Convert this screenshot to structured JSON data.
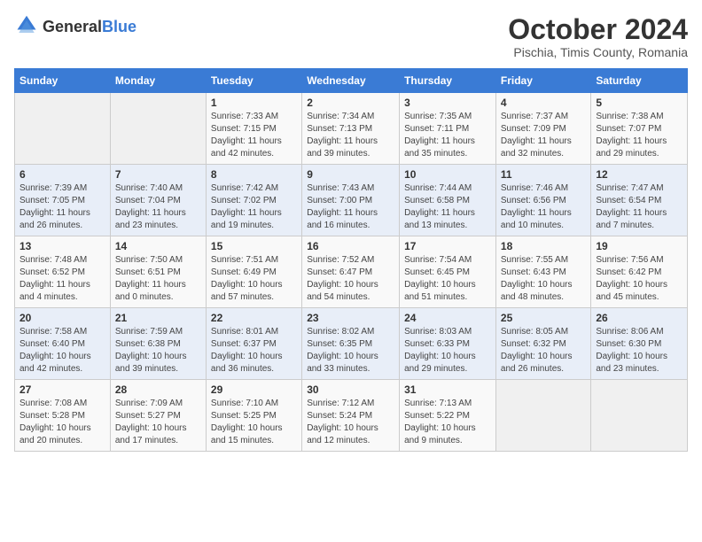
{
  "header": {
    "logo_general": "General",
    "logo_blue": "Blue",
    "month": "October 2024",
    "location": "Pischia, Timis County, Romania"
  },
  "days_of_week": [
    "Sunday",
    "Monday",
    "Tuesday",
    "Wednesday",
    "Thursday",
    "Friday",
    "Saturday"
  ],
  "weeks": [
    [
      {
        "day": "",
        "info": ""
      },
      {
        "day": "",
        "info": ""
      },
      {
        "day": "1",
        "info": "Sunrise: 7:33 AM\nSunset: 7:15 PM\nDaylight: 11 hours and 42 minutes."
      },
      {
        "day": "2",
        "info": "Sunrise: 7:34 AM\nSunset: 7:13 PM\nDaylight: 11 hours and 39 minutes."
      },
      {
        "day": "3",
        "info": "Sunrise: 7:35 AM\nSunset: 7:11 PM\nDaylight: 11 hours and 35 minutes."
      },
      {
        "day": "4",
        "info": "Sunrise: 7:37 AM\nSunset: 7:09 PM\nDaylight: 11 hours and 32 minutes."
      },
      {
        "day": "5",
        "info": "Sunrise: 7:38 AM\nSunset: 7:07 PM\nDaylight: 11 hours and 29 minutes."
      }
    ],
    [
      {
        "day": "6",
        "info": "Sunrise: 7:39 AM\nSunset: 7:05 PM\nDaylight: 11 hours and 26 minutes."
      },
      {
        "day": "7",
        "info": "Sunrise: 7:40 AM\nSunset: 7:04 PM\nDaylight: 11 hours and 23 minutes."
      },
      {
        "day": "8",
        "info": "Sunrise: 7:42 AM\nSunset: 7:02 PM\nDaylight: 11 hours and 19 minutes."
      },
      {
        "day": "9",
        "info": "Sunrise: 7:43 AM\nSunset: 7:00 PM\nDaylight: 11 hours and 16 minutes."
      },
      {
        "day": "10",
        "info": "Sunrise: 7:44 AM\nSunset: 6:58 PM\nDaylight: 11 hours and 13 minutes."
      },
      {
        "day": "11",
        "info": "Sunrise: 7:46 AM\nSunset: 6:56 PM\nDaylight: 11 hours and 10 minutes."
      },
      {
        "day": "12",
        "info": "Sunrise: 7:47 AM\nSunset: 6:54 PM\nDaylight: 11 hours and 7 minutes."
      }
    ],
    [
      {
        "day": "13",
        "info": "Sunrise: 7:48 AM\nSunset: 6:52 PM\nDaylight: 11 hours and 4 minutes."
      },
      {
        "day": "14",
        "info": "Sunrise: 7:50 AM\nSunset: 6:51 PM\nDaylight: 11 hours and 0 minutes."
      },
      {
        "day": "15",
        "info": "Sunrise: 7:51 AM\nSunset: 6:49 PM\nDaylight: 10 hours and 57 minutes."
      },
      {
        "day": "16",
        "info": "Sunrise: 7:52 AM\nSunset: 6:47 PM\nDaylight: 10 hours and 54 minutes."
      },
      {
        "day": "17",
        "info": "Sunrise: 7:54 AM\nSunset: 6:45 PM\nDaylight: 10 hours and 51 minutes."
      },
      {
        "day": "18",
        "info": "Sunrise: 7:55 AM\nSunset: 6:43 PM\nDaylight: 10 hours and 48 minutes."
      },
      {
        "day": "19",
        "info": "Sunrise: 7:56 AM\nSunset: 6:42 PM\nDaylight: 10 hours and 45 minutes."
      }
    ],
    [
      {
        "day": "20",
        "info": "Sunrise: 7:58 AM\nSunset: 6:40 PM\nDaylight: 10 hours and 42 minutes."
      },
      {
        "day": "21",
        "info": "Sunrise: 7:59 AM\nSunset: 6:38 PM\nDaylight: 10 hours and 39 minutes."
      },
      {
        "day": "22",
        "info": "Sunrise: 8:01 AM\nSunset: 6:37 PM\nDaylight: 10 hours and 36 minutes."
      },
      {
        "day": "23",
        "info": "Sunrise: 8:02 AM\nSunset: 6:35 PM\nDaylight: 10 hours and 33 minutes."
      },
      {
        "day": "24",
        "info": "Sunrise: 8:03 AM\nSunset: 6:33 PM\nDaylight: 10 hours and 29 minutes."
      },
      {
        "day": "25",
        "info": "Sunrise: 8:05 AM\nSunset: 6:32 PM\nDaylight: 10 hours and 26 minutes."
      },
      {
        "day": "26",
        "info": "Sunrise: 8:06 AM\nSunset: 6:30 PM\nDaylight: 10 hours and 23 minutes."
      }
    ],
    [
      {
        "day": "27",
        "info": "Sunrise: 7:08 AM\nSunset: 5:28 PM\nDaylight: 10 hours and 20 minutes."
      },
      {
        "day": "28",
        "info": "Sunrise: 7:09 AM\nSunset: 5:27 PM\nDaylight: 10 hours and 17 minutes."
      },
      {
        "day": "29",
        "info": "Sunrise: 7:10 AM\nSunset: 5:25 PM\nDaylight: 10 hours and 15 minutes."
      },
      {
        "day": "30",
        "info": "Sunrise: 7:12 AM\nSunset: 5:24 PM\nDaylight: 10 hours and 12 minutes."
      },
      {
        "day": "31",
        "info": "Sunrise: 7:13 AM\nSunset: 5:22 PM\nDaylight: 10 hours and 9 minutes."
      },
      {
        "day": "",
        "info": ""
      },
      {
        "day": "",
        "info": ""
      }
    ]
  ]
}
